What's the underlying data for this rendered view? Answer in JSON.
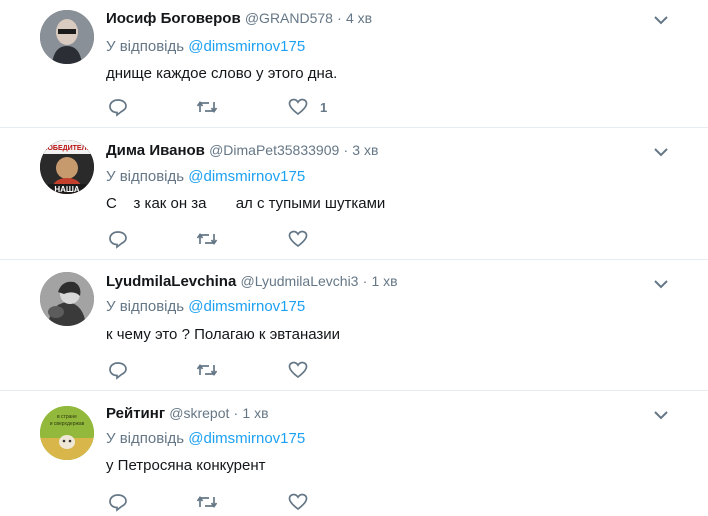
{
  "tweets": [
    {
      "name": "Иосиф Боговеров",
      "handle": "@GRAND578",
      "dot": "·",
      "time": "4 хв",
      "reply_prefix": "У відповідь",
      "reply_to": "@dimsmirnov175",
      "text": "днище каждое слово у этого дна.",
      "like_count": "1"
    },
    {
      "name": "Дима Иванов",
      "handle": "@DimaPet35833909",
      "dot": "·",
      "time": "3 хв",
      "reply_prefix": "У відповідь",
      "reply_to": "@dimsmirnov175",
      "text": "С    з как он за       ал с тупыми шутками",
      "avatar_text_top": "ПОБЕДИТЕЛЬ",
      "avatar_text_bottom": "НАША",
      "like_count": ""
    },
    {
      "name": "LyudmilaLevchina",
      "handle": "@LyudmilaLevchi3",
      "dot": "·",
      "time": "1 хв",
      "reply_prefix": "У відповідь",
      "reply_to": "@dimsmirnov175",
      "text": "к чему это ? Полагаю к эвтаназии",
      "like_count": ""
    },
    {
      "name": "Рейтинг",
      "handle": "@skrepot",
      "dot": "·",
      "time": "1 хв",
      "reply_prefix": "У відповідь",
      "reply_to": "@dimsmirnov175",
      "text": "у Петросяна конкурент",
      "avatar_text_top": "в стране",
      "avatar_text_bottom": "и сверхдержав",
      "like_count": ""
    }
  ],
  "icons": {
    "reply": "reply-icon",
    "retweet": "retweet-icon",
    "like": "heart-icon",
    "more": "chevron-down-icon"
  },
  "colors": {
    "text": "#14171a",
    "secondary": "#657786",
    "link": "#1da1f2",
    "border": "#e6ecf0"
  }
}
